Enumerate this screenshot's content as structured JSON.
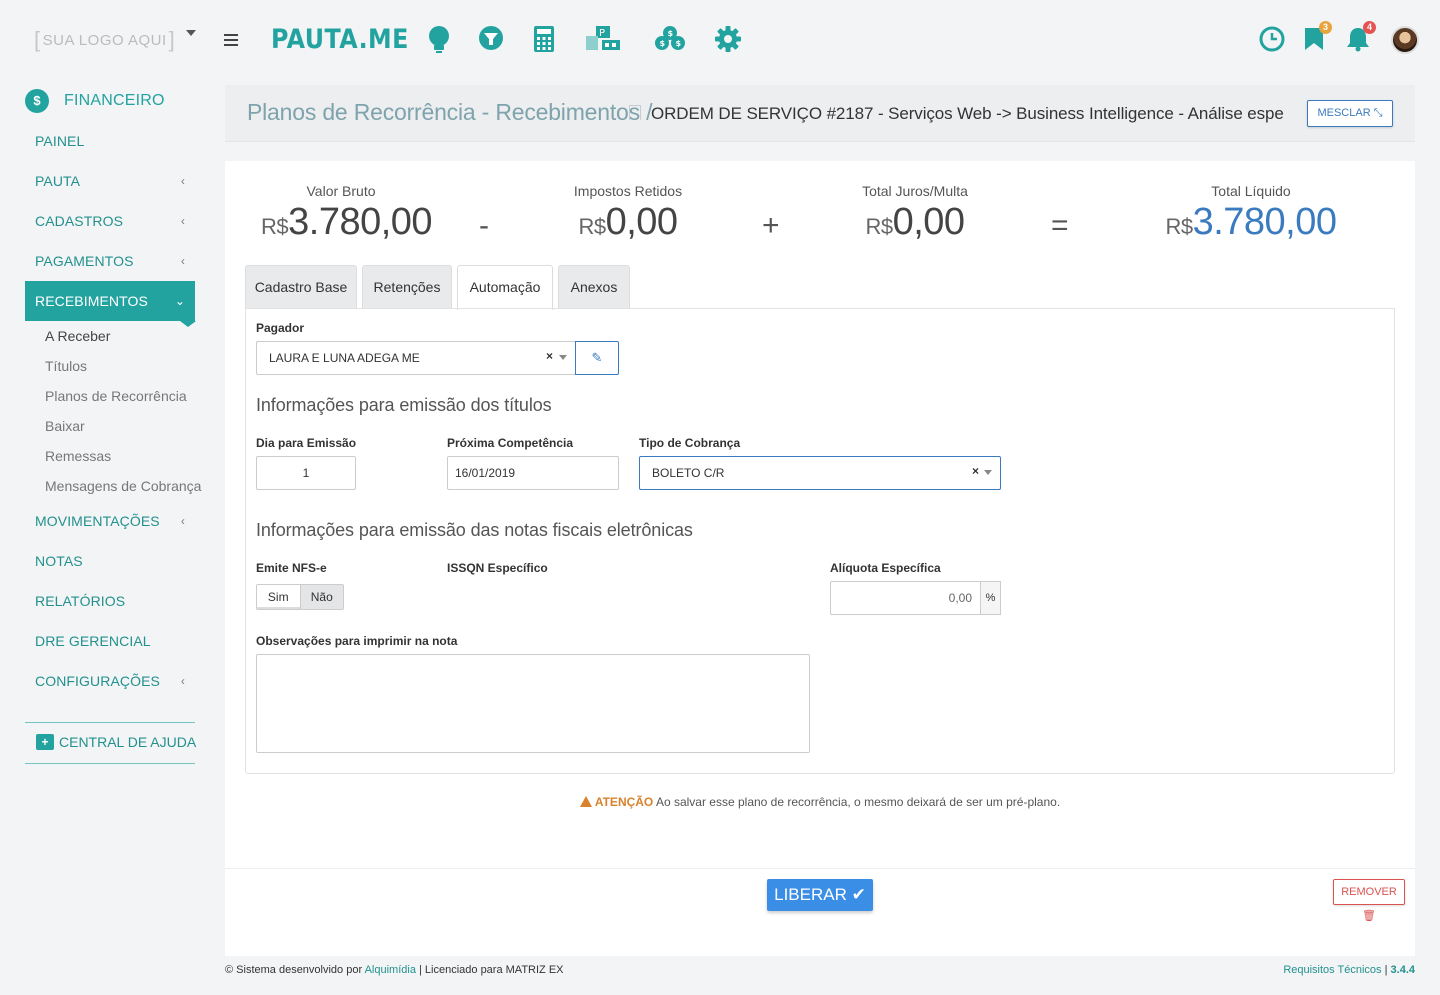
{
  "header": {
    "logo_text": "SUA LOGO AQUI",
    "brand": "PAUTA.ME",
    "badges": {
      "bookmarks": "3",
      "notifications": "4"
    },
    "colors": {
      "brand": "#22a3a0",
      "accent_blue": "#3a7bbf",
      "danger": "#d9534f",
      "warning": "#d9822b"
    }
  },
  "sidebar": {
    "section": "FINANCEIRO",
    "items": [
      {
        "label": "PAINEL",
        "has_submenu": false
      },
      {
        "label": "PAUTA",
        "has_submenu": true
      },
      {
        "label": "CADASTROS",
        "has_submenu": true
      },
      {
        "label": "PAGAMENTOS",
        "has_submenu": true
      },
      {
        "label": "RECEBIMENTOS",
        "has_submenu": true,
        "active": true
      },
      {
        "label": "MOVIMENTAÇÕES",
        "has_submenu": true
      },
      {
        "label": "NOTAS",
        "has_submenu": false
      },
      {
        "label": "RELATÓRIOS",
        "has_submenu": false
      },
      {
        "label": "DRE GERENCIAL",
        "has_submenu": false
      },
      {
        "label": "CONFIGURAÇÕES",
        "has_submenu": true
      }
    ],
    "submenu": [
      "A Receber",
      "Títulos",
      "Planos de Recorrência",
      "Baixar",
      "Remessas",
      "Mensagens de Cobrança"
    ],
    "help": "CENTRAL DE AJUDA"
  },
  "breadcrumb": {
    "main": "Planos de Recorrência - Recebimentos /",
    "sub": "ORDEM DE SERVIÇO #2187 - Serviços Web -> Business Intelligence - Análise espe",
    "merge_button": "MESCLAR"
  },
  "summary": {
    "currency": "R$",
    "valor_bruto": {
      "label": "Valor Bruto",
      "value": "3.780,00"
    },
    "op1": "-",
    "impostos": {
      "label": "Impostos Retidos",
      "value": "0,00"
    },
    "op2": "+",
    "juros": {
      "label": "Total Juros/Multa",
      "value": "0,00"
    },
    "op3": "=",
    "liquido": {
      "label": "Total Líquido",
      "value": "3.780,00"
    }
  },
  "tabs": [
    {
      "label": "Cadastro Base"
    },
    {
      "label": "Retenções"
    },
    {
      "label": "Automação",
      "active": true
    },
    {
      "label": "Anexos"
    }
  ],
  "form": {
    "pagador": {
      "label": "Pagador",
      "value": "LAURA E LUNA ADEGA ME"
    },
    "section_titles": "Informações para emissão dos títulos",
    "dia_emissao": {
      "label": "Dia para Emissão",
      "value": "1"
    },
    "proxima_competencia": {
      "label": "Próxima Competência",
      "value": "16/01/2019"
    },
    "tipo_cobranca": {
      "label": "Tipo de Cobrança",
      "value": "BOLETO C/R"
    },
    "section_nfe": "Informações para emissão das notas fiscais eletrônicas",
    "emite_nfse": {
      "label": "Emite NFS-e",
      "yes": "Sim",
      "no": "Não"
    },
    "issqn": {
      "label": "ISSQN Específico"
    },
    "aliquota": {
      "label": "Alíquota Específica",
      "value": "0,00",
      "suffix": "%"
    },
    "observacoes": {
      "label": "Observações para imprimir na nota",
      "value": ""
    }
  },
  "warning": {
    "title": "ATENÇÃO",
    "text": "Ao salvar esse plano de recorrência, o mesmo deixará de ser um pré-plano."
  },
  "actions": {
    "release": "LIBERAR",
    "remove": "REMOVER"
  },
  "footer": {
    "prefix": "© Sistema desenvolvido por",
    "company": "Alquimídia",
    "license": "| Licenciado para MATRIZ EX",
    "tech_req": "Requisitos Técnicos",
    "version": "3.4.4"
  }
}
